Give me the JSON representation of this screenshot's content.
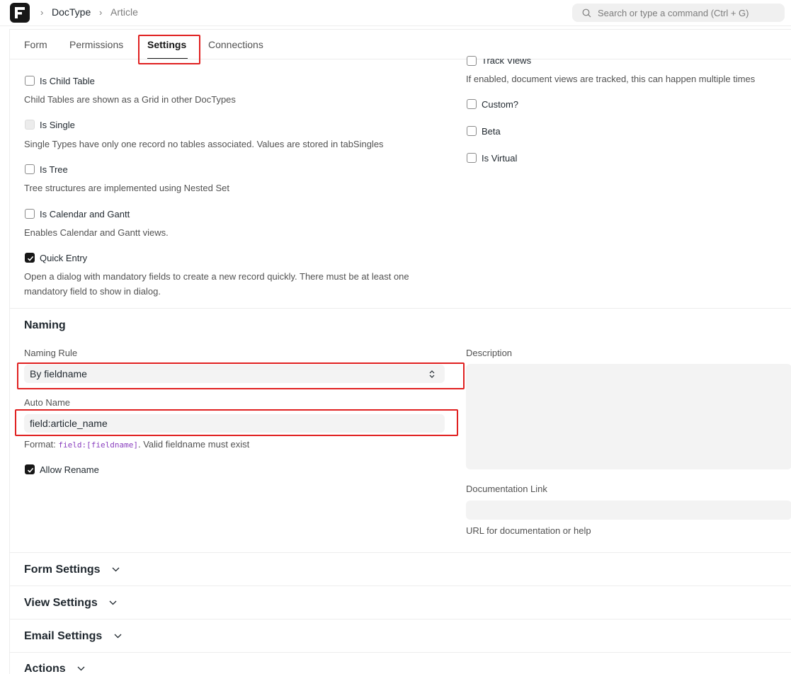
{
  "navbar": {
    "breadcrumbs": [
      "DocType",
      "Article"
    ],
    "search_placeholder": "Search or type a command (Ctrl + G)"
  },
  "tabs": [
    {
      "label": "Form"
    },
    {
      "label": "Permissions"
    },
    {
      "label": "Settings",
      "active": true
    },
    {
      "label": "Connections"
    }
  ],
  "left_checks": [
    {
      "label": "Is Child Table",
      "checked": false,
      "desc": "Child Tables are shown as a Grid in other DocTypes"
    },
    {
      "label": "Is Single",
      "checked": false,
      "disabled": true,
      "desc": "Single Types have only one record no tables associated. Values are stored in tabSingles"
    },
    {
      "label": "Is Tree",
      "checked": false,
      "desc": "Tree structures are implemented using Nested Set"
    },
    {
      "label": "Is Calendar and Gantt",
      "checked": false,
      "desc": "Enables Calendar and Gantt views."
    },
    {
      "label": "Quick Entry",
      "checked": true,
      "desc": "Open a dialog with mandatory fields to create a new record quickly. There must be at least one mandatory field to show in dialog."
    }
  ],
  "right_checks": {
    "track_views": {
      "label": "Track Views",
      "desc": "If enabled, document views are tracked, this can happen multiple times"
    },
    "custom": {
      "label": "Custom?"
    },
    "beta": {
      "label": "Beta"
    },
    "is_virtual": {
      "label": "Is Virtual"
    }
  },
  "naming": {
    "title": "Naming",
    "naming_rule_label": "Naming Rule",
    "naming_rule_value": "By fieldname",
    "auto_name_label": "Auto Name",
    "auto_name_value": "field:article_name",
    "format_prefix": "Format: ",
    "format_code": "field:[fieldname]",
    "format_suffix": ". Valid fieldname must exist",
    "allow_rename_label": "Allow Rename",
    "allow_rename_checked": true,
    "description_label": "Description",
    "doc_link_label": "Documentation Link",
    "doc_link_help": "URL for documentation or help"
  },
  "collapsed_sections": [
    "Form Settings",
    "View Settings",
    "Email Settings",
    "Actions"
  ],
  "colors": {
    "accent": "#171717",
    "highlight": "#e02020"
  }
}
